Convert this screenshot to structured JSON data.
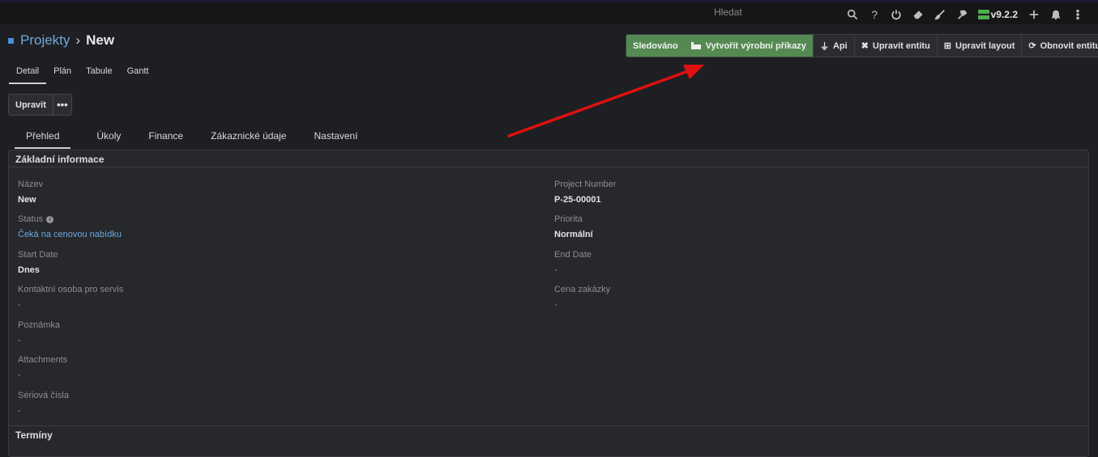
{
  "topbar": {
    "search_label": "Hledat",
    "version": "v9.2.2",
    "icons": [
      "search-icon",
      "help-icon",
      "power-icon",
      "eraser-icon",
      "brush-icon",
      "hammer-icon",
      "server-icon",
      "plus-icon",
      "bell-icon",
      "kebab-icon"
    ]
  },
  "breadcrumb": {
    "parent": "Projekty",
    "separator": "›",
    "current": "New"
  },
  "actions": {
    "followed": "Sledováno",
    "create_orders": "Vytvořit výrobní příkazy",
    "api": "Api",
    "edit_entity": "Upravit entitu",
    "edit_layout": "Upravit layout",
    "refresh_entity": "Obnovit entitu"
  },
  "view_tabs": [
    "Detail",
    "Plán",
    "Tabule",
    "Gantt"
  ],
  "edit": {
    "label": "Upravit",
    "more": "•••"
  },
  "sub_tabs": [
    "Přehled",
    "Úkoly",
    "Finance",
    "Zákaznické údaje",
    "Nastavení"
  ],
  "panel": {
    "title": "Základní informace",
    "fields": {
      "name": {
        "label": "Název",
        "value": "New"
      },
      "project_number": {
        "label": "Project Number",
        "value": "P-25-00001"
      },
      "status": {
        "label": "Status",
        "value": "Čeká na cenovou nabídku"
      },
      "priority": {
        "label": "Priorita",
        "value": "Normální"
      },
      "start_date": {
        "label": "Start Date",
        "value": "Dnes"
      },
      "end_date": {
        "label": "End Date",
        "value": "-"
      },
      "contact": {
        "label": "Kontaktní osoba pro servis",
        "value": "-"
      },
      "price": {
        "label": "Cena zakázky",
        "value": "-"
      },
      "note": {
        "label": "Poznámka",
        "value": "-"
      },
      "attachments": {
        "label": "Attachments",
        "value": "-"
      },
      "serials": {
        "label": "Sériová čísla",
        "value": "-"
      }
    },
    "section2_title": "Termíny"
  },
  "colors": {
    "accent_green": "#548a52",
    "link_blue": "#6fa8dc",
    "annotation_red": "#e01010"
  }
}
